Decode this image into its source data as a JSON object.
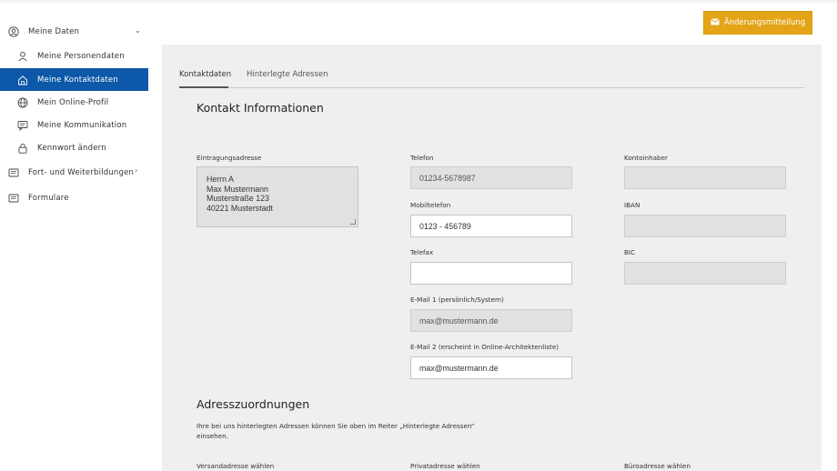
{
  "header": {
    "change_button_label": "Änderungsmitteilung",
    "change_button_icon": "envelope-icon",
    "accent": "#e3a418"
  },
  "sidebar": {
    "section_title": "Meine Daten",
    "items": [
      {
        "label": "Meine Personendaten",
        "icon": "person-icon"
      },
      {
        "label": "Meine Kontaktdaten",
        "icon": "home-icon",
        "active": true
      },
      {
        "label": "Mein Online-Profil",
        "icon": "globe-icon"
      },
      {
        "label": "Meine Kommunikation",
        "icon": "chat-icon"
      },
      {
        "label": "Kennwort ändern",
        "icon": "lock-icon"
      }
    ],
    "groups": [
      {
        "label": "Fort- und Weiterbildungen",
        "icon": "book-icon"
      },
      {
        "label": "Formulare",
        "icon": "form-icon"
      }
    ],
    "active_color": "#0d58a8"
  },
  "tabs": [
    {
      "label": "Kontaktdaten"
    },
    {
      "label": "Hinterlegte Adressen"
    }
  ],
  "contact": {
    "title": "Kontakt Informationen",
    "address_label": "Eintragungsadresse",
    "address_lines": [
      "Herrn A",
      "Max Mustermann",
      "Musterstraße 123",
      "40221 Musterstadt"
    ],
    "telefon_label": "Telefon",
    "telefon_value": "01234-5678987",
    "mobil_label": "Mobiltelefon",
    "mobil_value": "0123 - 456789",
    "telefax_label": "Telefax",
    "telefax_value": "",
    "email1_label": "E-Mail 1 (persönlich/System)",
    "email1_value": "max@mustermann.de",
    "email2_label": "E-Mail 2 (erscheint in Online-Architektenliste)",
    "email2_value": "max@mustermann.de",
    "kontoinhaber_label": "Kontoinhaber",
    "iban_label": "IBAN",
    "bic_label": "BIC"
  },
  "assign": {
    "title": "Adresszuordnungen",
    "text_line1": "Ihre bei uns hinterlegten Adressen können Sie oben im Reiter „Hinterlegte Adressen“",
    "text_line2": "einsehen.",
    "versand_label": "Versandadresse wählen",
    "privat_label": "Privatadresse wählen",
    "buero_label": "Büroadresse wählen"
  }
}
